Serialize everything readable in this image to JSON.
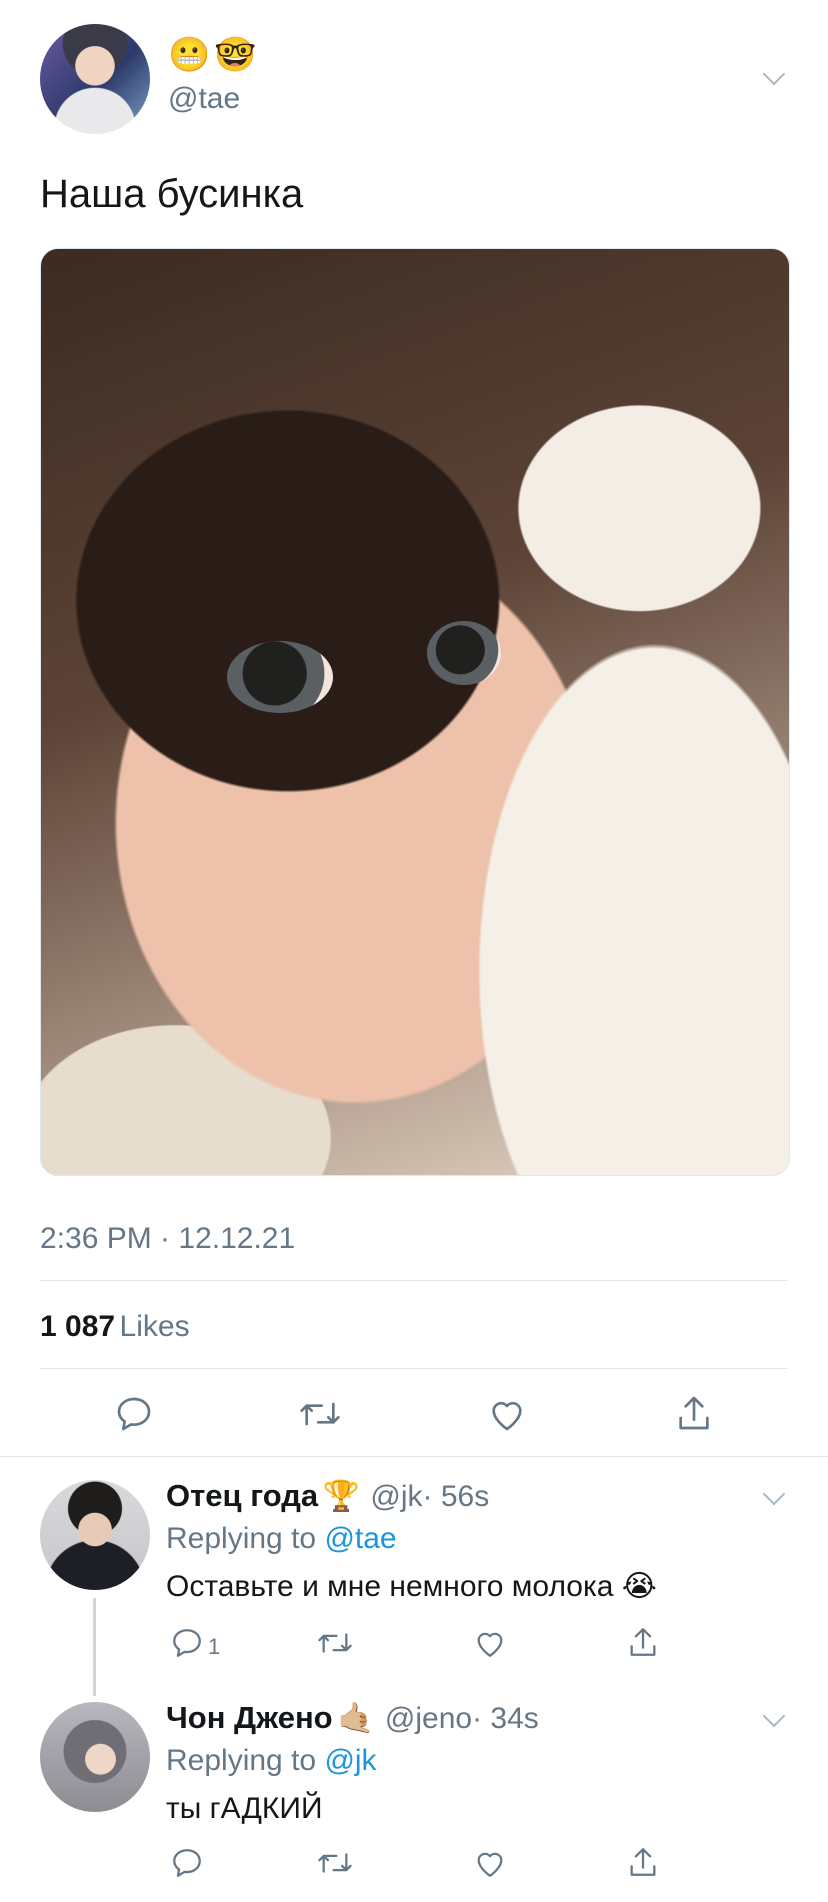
{
  "tweet": {
    "emojis": [
      "😬",
      "🤓"
    ],
    "handle": "@tae",
    "text": "Наша бусинка",
    "timestamp": "2:36 PM · 12.12.21",
    "likes_count": "1 087",
    "likes_label": "Likes"
  },
  "replies": [
    {
      "name": "Отец года",
      "name_emoji": "🏆",
      "handle": "@jk",
      "time": "· 56s",
      "replying_prefix": "Replying to",
      "replying_to": "@tae",
      "text": "Оставьте и мне немного молока",
      "text_emoji": "😭",
      "reply_count": "1"
    },
    {
      "name": "Чон Джено",
      "name_emoji": "🤙🏼",
      "handle": "@jeno",
      "time": "· 34s",
      "replying_prefix": "Replying to",
      "replying_to": "@jk",
      "text": "ты гАДКИЙ"
    }
  ],
  "icons": {
    "reply": "reply-icon",
    "retweet": "retweet-icon",
    "like": "like-icon",
    "share": "share-icon",
    "more": "chevron-down-icon"
  },
  "colors": {
    "text": "#14171a",
    "secondary": "#657786",
    "link": "#1b95e0",
    "divider": "#e1e8ed"
  }
}
